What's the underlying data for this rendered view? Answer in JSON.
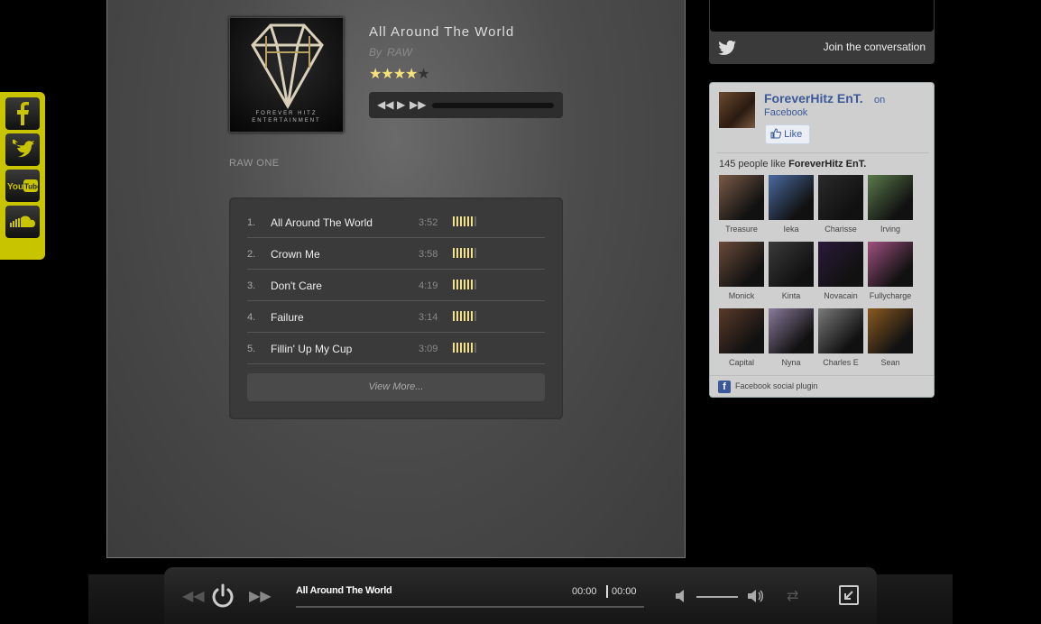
{
  "social": {
    "items": [
      {
        "name": "facebook",
        "icon": "facebook-icon"
      },
      {
        "name": "twitter",
        "icon": "bird-icon"
      },
      {
        "name": "youtube",
        "icon": "youtube-icon",
        "label": "You Tube"
      },
      {
        "name": "soundcloud",
        "icon": "soundcloud-icon"
      }
    ]
  },
  "album": {
    "cover_text_1": "FOREVER HITZ",
    "cover_text_2": "ENTERTAINMENT",
    "song_title": "All Around The World",
    "by_label": "By",
    "artist": "RAW",
    "rating": 4,
    "rating_max": 5,
    "album_name": "RAW ONE"
  },
  "tracks": [
    {
      "num": "1.",
      "name": "All Around The World",
      "duration": "3:52"
    },
    {
      "num": "2.",
      "name": "Crown Me",
      "duration": "3:58"
    },
    {
      "num": "3.",
      "name": "Don't Care",
      "duration": "4:19"
    },
    {
      "num": "4.",
      "name": "Failure",
      "duration": "3:14"
    },
    {
      "num": "5.",
      "name": "Fillin' Up My Cup",
      "duration": "3:09"
    }
  ],
  "view_more": "View More...",
  "twitter": {
    "join_label": "Join the conversation"
  },
  "facebook": {
    "page_name": "ForeverHitz EnT.",
    "on_label": "on",
    "facebook_label": "Facebook",
    "like_label": "Like",
    "count_prefix": "145 people like",
    "count_page": "ForeverHitz EnT.",
    "fans": [
      {
        "name": "Treasure",
        "color": "#7a5a48"
      },
      {
        "name": "Ieka",
        "color": "#4a6aa0"
      },
      {
        "name": "Charisse",
        "color": "#2a2a2a"
      },
      {
        "name": "Irving",
        "color": "#5a7a4a"
      },
      {
        "name": "Monick",
        "color": "#6a4a3a"
      },
      {
        "name": "Kinta",
        "color": "#3a3a3a"
      },
      {
        "name": "Novacain",
        "color": "#2a1a3a"
      },
      {
        "name": "Fullycharge",
        "color": "#a05080"
      },
      {
        "name": "Capital",
        "color": "#5a3a2a"
      },
      {
        "name": "Nyna",
        "color": "#8a7a9a"
      },
      {
        "name": "Charles E",
        "color": "#7a7a7a"
      },
      {
        "name": "Sean",
        "color": "#8a5a20"
      }
    ],
    "plugin_label": "Facebook social plugin"
  },
  "player": {
    "title": "All Around The World",
    "time_current": "00:00",
    "time_total": "00:00"
  }
}
